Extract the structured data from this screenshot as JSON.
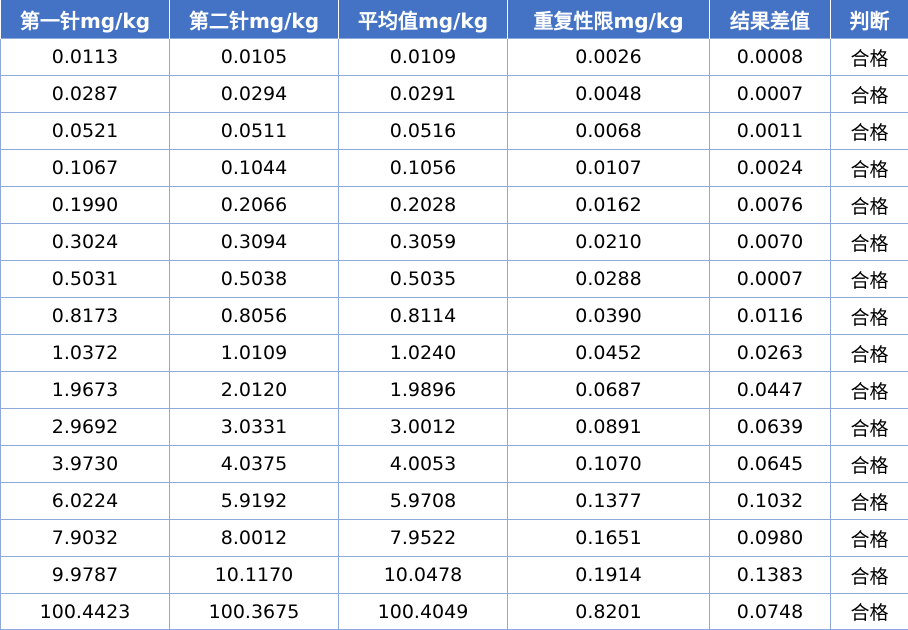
{
  "table": {
    "headers": [
      "第一针mg/kg",
      "第二针mg/kg",
      "平均值mg/kg",
      "重复性限mg/kg",
      "结果差值",
      "判断"
    ],
    "rows": [
      [
        "0.0113",
        "0.0105",
        "0.0109",
        "0.0026",
        "0.0008",
        "合格"
      ],
      [
        "0.0287",
        "0.0294",
        "0.0291",
        "0.0048",
        "0.0007",
        "合格"
      ],
      [
        "0.0521",
        "0.0511",
        "0.0516",
        "0.0068",
        "0.0011",
        "合格"
      ],
      [
        "0.1067",
        "0.1044",
        "0.1056",
        "0.0107",
        "0.0024",
        "合格"
      ],
      [
        "0.1990",
        "0.2066",
        "0.2028",
        "0.0162",
        "0.0076",
        "合格"
      ],
      [
        "0.3024",
        "0.3094",
        "0.3059",
        "0.0210",
        "0.0070",
        "合格"
      ],
      [
        "0.5031",
        "0.5038",
        "0.5035",
        "0.0288",
        "0.0007",
        "合格"
      ],
      [
        "0.8173",
        "0.8056",
        "0.8114",
        "0.0390",
        "0.0116",
        "合格"
      ],
      [
        "1.0372",
        "1.0109",
        "1.0240",
        "0.0452",
        "0.0263",
        "合格"
      ],
      [
        "1.9673",
        "2.0120",
        "1.9896",
        "0.0687",
        "0.0447",
        "合格"
      ],
      [
        "2.9692",
        "3.0331",
        "3.0012",
        "0.0891",
        "0.0639",
        "合格"
      ],
      [
        "3.9730",
        "4.0375",
        "4.0053",
        "0.1070",
        "0.0645",
        "合格"
      ],
      [
        "6.0224",
        "5.9192",
        "5.9708",
        "0.1377",
        "0.1032",
        "合格"
      ],
      [
        "7.9032",
        "8.0012",
        "7.9522",
        "0.1651",
        "0.0980",
        "合格"
      ],
      [
        "9.9787",
        "10.1170",
        "10.0478",
        "0.1914",
        "0.1383",
        "合格"
      ],
      [
        "100.4423",
        "100.3675",
        "100.4049",
        "0.8201",
        "0.0748",
        "合格"
      ]
    ]
  },
  "colors": {
    "header_bg": "#4472c4",
    "header_text": "#ffffff",
    "grid_line": "#8eaadb"
  }
}
